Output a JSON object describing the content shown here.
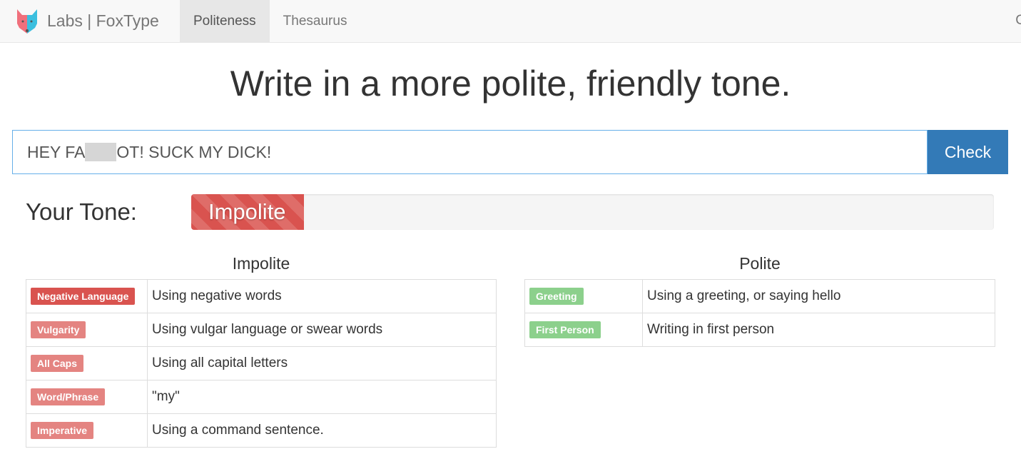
{
  "nav": {
    "brand": "Labs | FoxType",
    "tabs": [
      {
        "label": "Politeness",
        "active": true
      },
      {
        "label": "Thesaurus",
        "active": false
      }
    ],
    "right_partial": "C"
  },
  "heading": "Write in a more polite, friendly tone.",
  "input": {
    "value_before_redaction": "HEY FA",
    "value_after_redaction": "OT! SUCK MY DICK!",
    "redacted": true
  },
  "check_button": "Check",
  "tone": {
    "label": "Your Tone:",
    "value": "Impolite",
    "level_percent": 14,
    "color": "#d9534f"
  },
  "impolite": {
    "title": "Impolite",
    "rows": [
      {
        "tag": "Negative Language",
        "desc": "Using negative words",
        "color": "#d9534f"
      },
      {
        "tag": "Vulgarity",
        "desc": "Using vulgar language or swear words",
        "color": "#e48481"
      },
      {
        "tag": "All Caps",
        "desc": "Using all capital letters",
        "color": "#e48481"
      },
      {
        "tag": "Word/Phrase",
        "desc": "\"my\"",
        "color": "#e48481"
      },
      {
        "tag": "Imperative",
        "desc": "Using a command sentence.",
        "color": "#e48481"
      }
    ]
  },
  "polite": {
    "title": "Polite",
    "rows": [
      {
        "tag": "Greeting",
        "desc": "Using a greeting, or saying hello",
        "color": "#8cd08c"
      },
      {
        "tag": "First Person",
        "desc": "Writing in first person",
        "color": "#8cd08c"
      }
    ]
  }
}
